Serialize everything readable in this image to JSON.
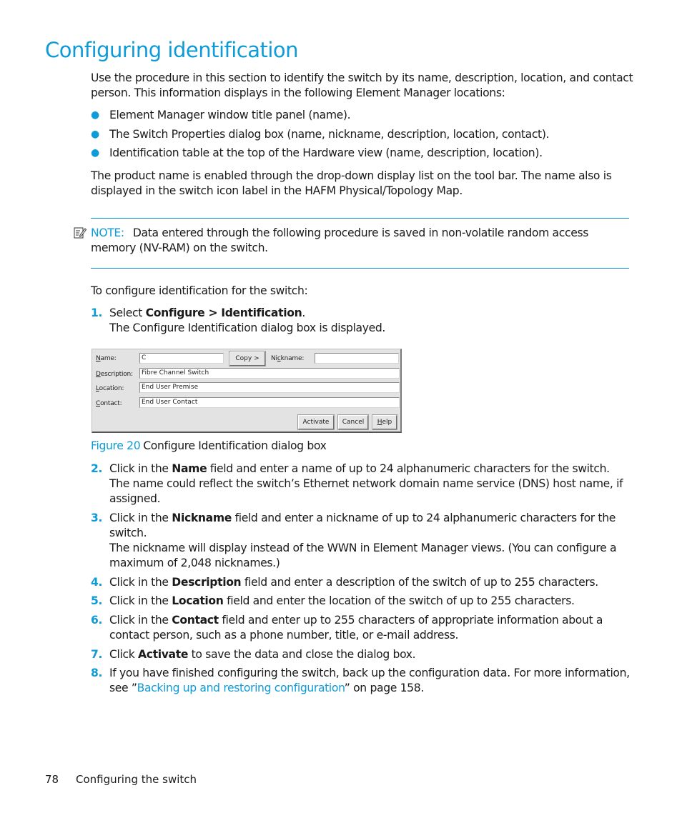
{
  "heading": "Configuring identification",
  "intro": "Use the procedure in this section to identify the switch by its name, description, location, and contact person. This information displays in the following Element Manager locations:",
  "bullets": [
    "Element Manager window title panel (name).",
    "The Switch Properties dialog box (name, nickname, description, location, contact).",
    "Identification table at the top of the Hardware view (name, description, location)."
  ],
  "product_para": "The product name is enabled through the drop-down display list on the tool bar. The name also is displayed in the switch icon label in the HAFM Physical/Topology Map.",
  "note": {
    "icon": "note-pencil-icon",
    "label": "NOTE:",
    "text": "Data entered through the following procedure is saved in non-volatile random access memory (NV-RAM) on the switch."
  },
  "procedure_intro": "To configure identification for the switch:",
  "steps": [
    {
      "num": "1.",
      "pre": "Select ",
      "bold": "Configure > Identification",
      "post": ".",
      "extra": "The Configure Identification dialog box is displayed."
    },
    {
      "num": "2.",
      "pre": "Click in the ",
      "bold": "Name",
      "post": " field and enter a name of up to 24 alphanumeric characters for the switch. The name could reflect the switch’s Ethernet network domain name service (DNS) host name, if assigned."
    },
    {
      "num": "3.",
      "pre": "Click in the ",
      "bold": "Nickname",
      "post": " field and enter a nickname of up to 24 alphanumeric characters for the switch.",
      "extra": "The nickname will display instead of the WWN in Element Manager views. (You can configure a maximum of 2,048 nicknames.)"
    },
    {
      "num": "4.",
      "pre": "Click in the ",
      "bold": "Description",
      "post": " field and enter a description of the switch of up to 255 characters."
    },
    {
      "num": "5.",
      "pre": "Click in the ",
      "bold": "Location",
      "post": " field and enter the location of the switch of up to 255 characters."
    },
    {
      "num": "6.",
      "pre": "Click in the ",
      "bold": "Contact",
      "post": " field and enter up to 255 characters of appropriate information about a contact person, such as a phone number, title, or e-mail address."
    },
    {
      "num": "7.",
      "pre": "Click ",
      "bold": "Activate",
      "post": " to save the data and close the dialog box."
    },
    {
      "num": "8.",
      "pre": "If you have finished configuring the switch, back up the configuration data. For more information, see ”",
      "link": "Backing up and restoring configuration",
      "post": "” on page 158."
    }
  ],
  "dialog": {
    "name_label_u": "N",
    "name_label_rest": "ame:",
    "name_value": "C",
    "copy_button": "Copy >",
    "nickname_label_pre": "Ni",
    "nickname_label_u": "c",
    "nickname_label_rest": "kname:",
    "nickname_value": "",
    "description_label_u": "D",
    "description_label_rest": "escription:",
    "description_value": "Fibre Channel Switch",
    "location_label_u": "L",
    "location_label_rest": "ocation:",
    "location_value": "End User Premise",
    "contact_label_u": "C",
    "contact_label_rest": "ontact:",
    "contact_value": "End User Contact",
    "activate_button": "Activate",
    "cancel_button": "Cancel",
    "help_button_u": "H",
    "help_button_rest": "elp"
  },
  "figure_caption": {
    "label": "Figure 20",
    "text": "Configure Identification dialog box"
  },
  "footer": {
    "page_number": "78",
    "section": "Configuring the switch"
  }
}
